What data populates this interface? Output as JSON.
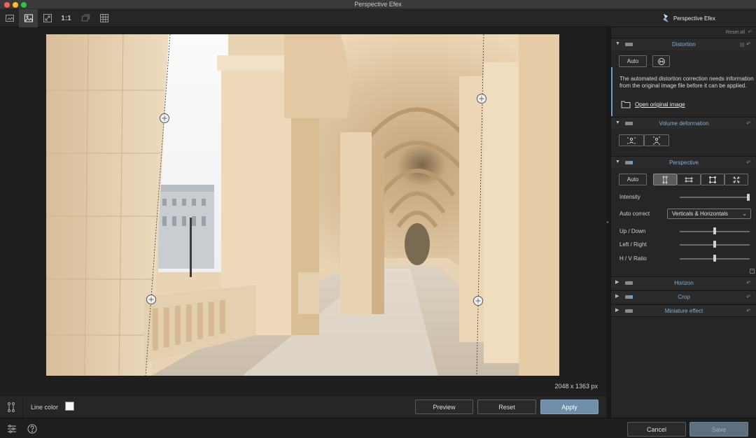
{
  "window": {
    "title": "Perspective Efex"
  },
  "toolbar": {
    "one_to_one_label": "1:1",
    "brand_name": "Perspective Efex"
  },
  "canvas": {
    "dimensions": "2048 x 1363 px"
  },
  "linebar": {
    "line_color_label": "Line color",
    "swatch_color": "#f4f4f4",
    "preview_label": "Preview",
    "reset_label": "Reset",
    "apply_label": "Apply"
  },
  "footer": {
    "cancel_label": "Cancel",
    "save_label": "Save"
  },
  "panel": {
    "reset_all_label": "Reset all",
    "distortion": {
      "title": "Distortion",
      "auto_label": "Auto",
      "info_text": "The automated distortion correction needs information from the original image file before it can be applied.",
      "open_original_label": "Open original image"
    },
    "volume": {
      "title": "Volume deformation"
    },
    "perspective": {
      "title": "Perspective",
      "auto_label": "Auto",
      "intensity_label": "Intensity",
      "intensity_value": 1.0,
      "auto_correct_label": "Auto correct",
      "auto_correct_value": "Verticals & Horizontals",
      "up_down_label": "Up / Down",
      "up_down_value": 0.5,
      "left_right_label": "Left / Right",
      "left_right_value": 0.5,
      "hv_ratio_label": "H / V Ratio",
      "hv_ratio_value": 0.5
    },
    "horizon": {
      "title": "Horizon"
    },
    "crop": {
      "title": "Crop"
    },
    "miniature": {
      "title": "Miniature effect"
    }
  },
  "colors": {
    "accent_blue": "#7cb0da",
    "apply_button": "#6f8ea8",
    "panel_bg": "#262626"
  }
}
